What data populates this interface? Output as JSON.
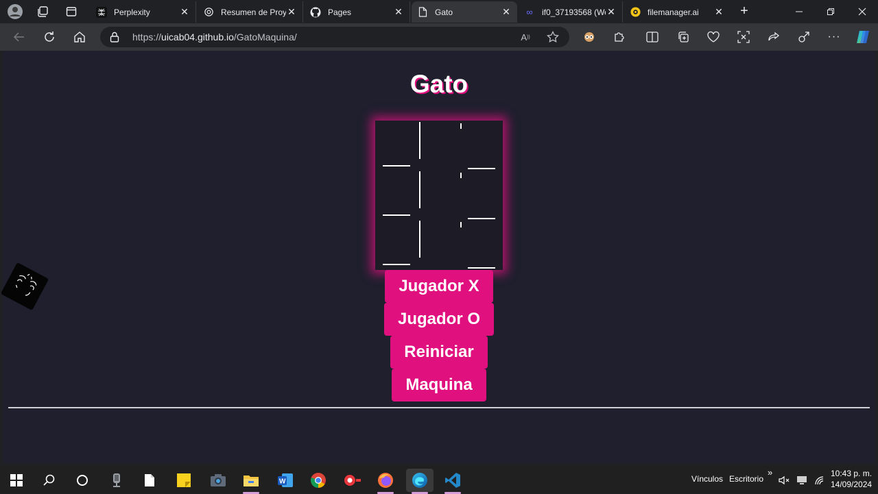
{
  "tabs": [
    {
      "label": "Perplexity",
      "active": false
    },
    {
      "label": "Resumen de Proye",
      "active": false
    },
    {
      "label": "Pages",
      "active": false
    },
    {
      "label": "Gato",
      "active": true
    },
    {
      "label": "if0_37193568 (We",
      "active": false
    },
    {
      "label": "filemanager.ai",
      "active": false
    }
  ],
  "address": {
    "prefix": "https://",
    "host": "uicab04.github.io",
    "path": "/GatoMaquina/"
  },
  "page": {
    "title": "Gato",
    "buttons": {
      "player_x": "Jugador X",
      "player_o": "Jugador O",
      "reset": "Reiniciar",
      "machine": "Maquina"
    }
  },
  "taskbar": {
    "links_label": "Vínculos",
    "desktop_label": "Escritorio",
    "time": "10:43 p. m.",
    "date": "14/09/2024"
  },
  "colors": {
    "accent": "#e0117f",
    "page_bg": "#1f1f2e",
    "chrome_bg": "#202124"
  }
}
